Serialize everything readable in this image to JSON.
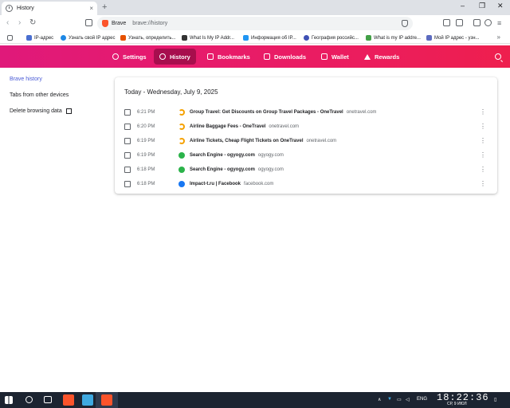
{
  "browser": {
    "tab_title": "History",
    "tab_close": "×",
    "new_tab": "+",
    "omnibox_brave": "Brave",
    "omnibox_url": "brave://history",
    "window_controls": [
      "–",
      "❐",
      "✕"
    ],
    "nav": {
      "back": "‹",
      "forward": "›",
      "reload": "↻"
    }
  },
  "bookmarks": [
    {
      "label": "IP-адрес",
      "color": "#4a6fd0"
    },
    {
      "label": "Узнать свой IP адрес",
      "color": "#1e88e5"
    },
    {
      "label": "Узнать, определить...",
      "color": "#e65100"
    },
    {
      "label": "What Is My IP Addr...",
      "color": "#333333"
    },
    {
      "label": "Информация об IP...",
      "color": "#2196f3"
    },
    {
      "label": "География российс...",
      "color": "#3f51b5"
    },
    {
      "label": "What is my IP addre...",
      "color": "#43a047"
    },
    {
      "label": "Мой IP адрес - узн...",
      "color": "#5c6bc0"
    }
  ],
  "bookmarks_more": "»",
  "header": {
    "nav": [
      {
        "label": "Settings",
        "icon": "gear-icon",
        "active": false
      },
      {
        "label": "History",
        "icon": "clock-icon",
        "active": true
      },
      {
        "label": "Bookmarks",
        "icon": "bookmark-icon",
        "active": false
      },
      {
        "label": "Downloads",
        "icon": "download-icon",
        "active": false
      },
      {
        "label": "Wallet",
        "icon": "wallet-icon",
        "active": false
      },
      {
        "label": "Rewards",
        "icon": "triangle-icon",
        "active": false
      }
    ],
    "accent": "#e8196b"
  },
  "sidebar": {
    "items": [
      {
        "label": "Brave history",
        "active": true
      },
      {
        "label": "Tabs from other devices",
        "active": false
      },
      {
        "label": "Delete browsing data",
        "active": false
      }
    ]
  },
  "history": {
    "date_heading": "Today - Wednesday, July 9, 2025",
    "entries": [
      {
        "time": "6:21 PM",
        "title": "Group Travel: Get Discounts on Group Travel Packages - OneTravel",
        "domain": "onetravel.com",
        "icon": "onetravel-icon",
        "icon_color": "#f5a100"
      },
      {
        "time": "6:20 PM",
        "title": "Airline Baggage Fees - OneTravel",
        "domain": "onetravel.com",
        "icon": "onetravel-icon",
        "icon_color": "#f5a100"
      },
      {
        "time": "6:19 PM",
        "title": "Airline Tickets, Cheap Flight Tickets on OneTravel",
        "domain": "onetravel.com",
        "icon": "onetravel-icon",
        "icon_color": "#f5a100"
      },
      {
        "time": "6:19 PM",
        "title": "Search Engine - ogyogy.com",
        "domain": "ogyogy.com",
        "icon": "ogyogy-icon",
        "icon_color": "#2bb34a"
      },
      {
        "time": "6:18 PM",
        "title": "Search Engine - ogyogy.com",
        "domain": "ogyogy.com",
        "icon": "ogyogy-icon",
        "icon_color": "#2bb34a"
      },
      {
        "time": "6:18 PM",
        "title": "Impact-t.ru | Facebook",
        "domain": "facebook.com",
        "icon": "facebook-icon",
        "icon_color": "#1877f2"
      }
    ],
    "menu_glyph": "⋮"
  },
  "taskbar": {
    "lang": "ENG",
    "time": "18:22:36",
    "date": "СР, 9 ИЮЛ"
  }
}
